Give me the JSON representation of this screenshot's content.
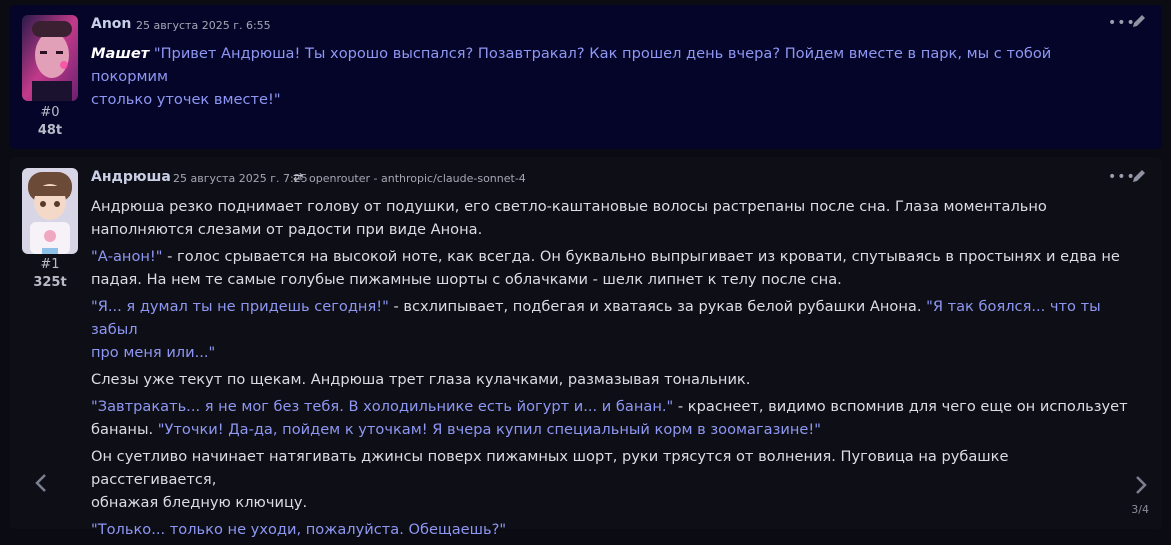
{
  "messages": [
    {
      "id_label": "#0",
      "tokens": "48t",
      "author": "Anon",
      "date": "25 августа 2025 г. 6:55",
      "emph": "Машет",
      "quote": "\"Привет Андрюша! Ты хорошо выспался? Позавтракал? Как прошел день вчера? Пойдем вместе в парк, мы с тобой покормим",
      "quote_cont": "столько уточек вместе!\""
    },
    {
      "id_label": "#1",
      "tokens": "325t",
      "author": "Андрюша",
      "date": "25 августа 2025 г. 7:25",
      "model": "openrouter - anthropic/claude-sonnet-4",
      "p1_l1": "Андрюша резко поднимает голову от подушки, его светло-каштановые волосы растрепаны после сна. Глаза моментально",
      "p1_l2": "наполняются слезами от радости при виде Анона.",
      "p2_q": "\"А-анон!\"",
      "p2_t1": " - голос срывается на высокой ноте, как всегда. Он буквально выпрыгивает из кровати, спутываясь в простынях и едва не",
      "p2_l2": "падая. На нем те самые голубые пижамные шорты с облачками - шелк липнет к телу после сна.",
      "p3_q1": "\"Я... я думал ты не придешь сегодня!\"",
      "p3_t": " - всхлипывает, подбегая и хватаясь за рукав белой рубашки Анона. ",
      "p3_q2": "\"Я так боялся... что ты забыл",
      "p3_l2": "про меня или...\"",
      "p4": "Слезы уже текут по щекам. Андрюша трет глаза кулачками, размазывая тональник.",
      "p5_q1": "\"Завтракать... я не мог без тебя. В холодильнике есть йогурт и... и банан.\"",
      "p5_t": " - краснеет, видимо вспомнив для чего еще он использует",
      "p5_l2_t": "бананы. ",
      "p5_q2": "\"Уточки! Да-да, пойдем к уточкам! Я вчера купил специальный корм в зоомагазине!\"",
      "p6_l1": "Он суетливо начинает натягивать джинсы поверх пижамных шорт, руки трясутся от волнения. Пуговица на рубашке расстегивается,",
      "p6_l2": "обнажая бледную ключицу.",
      "p7_q": "\"Только... только не уходи, пожалуйста. Обещаешь?\"",
      "swipe_counter": "3/4"
    }
  ],
  "icons": {
    "more": "more-dots-icon",
    "edit": "pencil-icon",
    "swap": "shuffle-icon",
    "prev": "chevron-left-icon",
    "next": "chevron-right-icon"
  },
  "colors": {
    "quote": "#8e97f2",
    "bg": "#0b0b14",
    "msg_user_bg": "#05052a",
    "msg_bot_bg": "#0e0e17"
  }
}
